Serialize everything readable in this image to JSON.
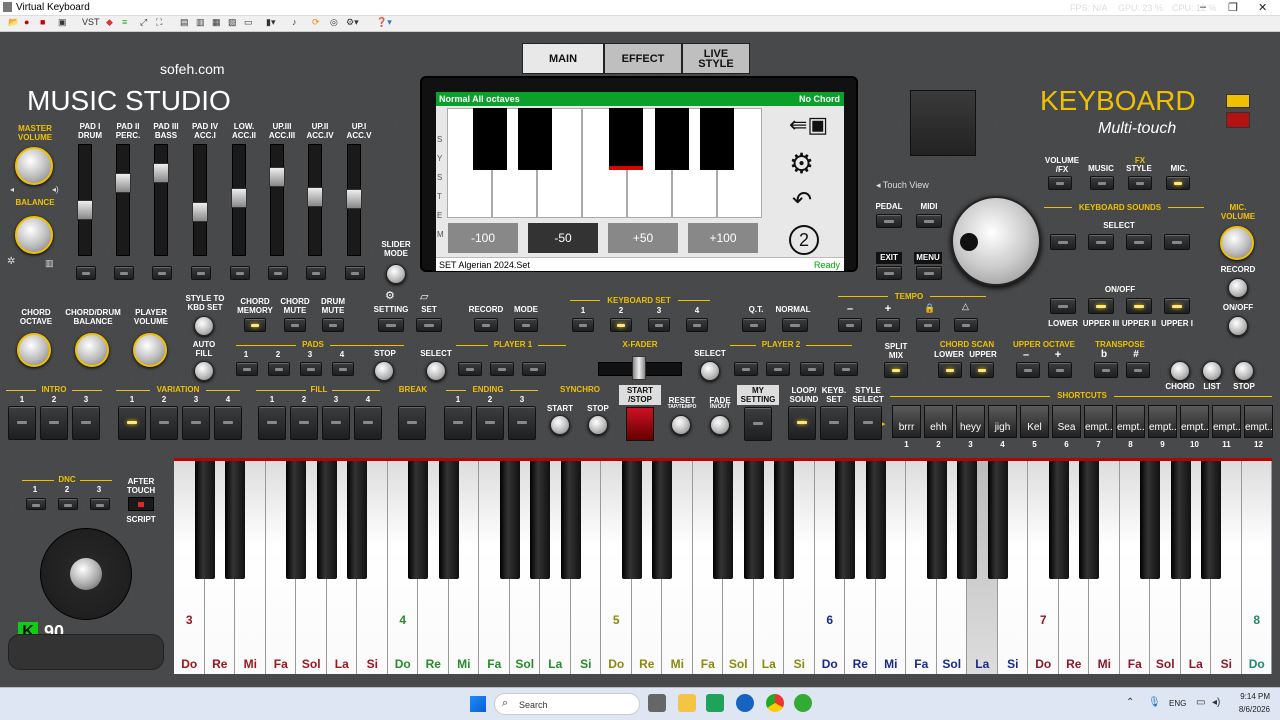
{
  "window": {
    "title": "Virtual Keyboard",
    "controls": [
      "–",
      "❐",
      "✕"
    ]
  },
  "toolbar": {
    "vst": "VST"
  },
  "overlay": {
    "fps": "FPS: N/A",
    "gpu": "GPU: 23 %",
    "cpu": "CPU: 12 %"
  },
  "brand": {
    "site": "sofeh.com",
    "app": "MUSIC STUDIO",
    "kb": "KEYBOARD",
    "kb_sub": "Multi-touch"
  },
  "tabs": [
    {
      "label": "MAIN"
    },
    {
      "label": "EFFECT"
    },
    {
      "label": "LIVE\nSTYLE"
    }
  ],
  "screen": {
    "header": "Normal All octaves",
    "chord": "No Chord",
    "side": "S\nY\nS\nT\nE\nM",
    "values": [
      "-100",
      "-50",
      "+50",
      "+100"
    ],
    "footer_set": "SET Algerian 2024.Set",
    "status": "Ready",
    "page": "2"
  },
  "left": {
    "master_volume": "MASTER\nVOLUME",
    "balance": "BALANCE",
    "pads": [
      "PAD I\nDRUM",
      "PAD II\nPERC.",
      "PAD III\nBASS",
      "PAD IV\nACC.I",
      "LOW.\nACC.II",
      "UP.III\nACC.III",
      "UP.II\nACC.IV",
      "UP.I\nACC.V"
    ],
    "slider_mode": "SLIDER\nMODE"
  },
  "row2": {
    "chord_octave": "CHORD\nOCTAVE",
    "chord_drum_balance": "CHORD/DRUM\nBALANCE",
    "player_volume": "PLAYER\nVOLUME",
    "style_to_kbd": "STYLE TO\nKBD SET",
    "auto_fill": "AUTO\nFILL",
    "chord_memory": "CHORD\nMEMORY",
    "chord_mute": "CHORD\nMUTE",
    "drum_mute": "DRUM\nMUTE",
    "setting": "SETTING",
    "set": "SET",
    "record": "RECORD",
    "mode": "MODE",
    "keyboard_set": "KEYBOARD SET",
    "kbset_nums": [
      "1",
      "2",
      "3",
      "4"
    ],
    "qt": "Q.T.",
    "normal": "NORMAL",
    "tempo": "TEMPO",
    "tempo_btns": [
      "–",
      "+"
    ],
    "pads_lbl": "PADS",
    "pads_nums": [
      "1",
      "2",
      "3",
      "4"
    ],
    "stop": "STOP",
    "select": "SELECT",
    "player1": "PLAYER 1",
    "xfader": "X-FADER",
    "player2": "PLAYER 2",
    "select2": "SELECT",
    "split_mix": "SPLIT\nMIX",
    "chord_scan": "CHORD SCAN",
    "lower": "LOWER",
    "upper": "UPPER",
    "upper_octave": "UPPER OCTAVE",
    "uo_btns": [
      "–",
      "+"
    ],
    "transpose": "TRANSPOSE",
    "tr_btns": [
      "b",
      "#"
    ]
  },
  "right": {
    "volume_fx": "VOLUME\n/FX",
    "fx": "FX",
    "music": "MUSIC",
    "style": "STYLE",
    "mic": "MIC.",
    "touch_view": "Touch View",
    "pedal": "PEDAL",
    "midi": "MIDI",
    "exit": "EXIT",
    "menu": "MENU",
    "keyboard_sounds": "KEYBOARD SOUNDS",
    "select": "SELECT",
    "on_off": "ON/OFF",
    "sound_labels": [
      "LOWER",
      "UPPER III",
      "UPPER II",
      "UPPER I"
    ],
    "mic_volume": "MIC.\nVOLUME",
    "record": "RECORD",
    "on_off2": "ON/OFF",
    "chord": "CHORD",
    "list": "LIST",
    "stop": "STOP"
  },
  "row3": {
    "intro": "INTRO",
    "intro_n": [
      "1",
      "2",
      "3"
    ],
    "variation": "VARIATION",
    "var_n": [
      "1",
      "2",
      "3",
      "4"
    ],
    "fill": "FILL",
    "fill_n": [
      "1",
      "2",
      "3",
      "4"
    ],
    "break": "BREAK",
    "ending": "ENDING",
    "end_n": [
      "1",
      "2",
      "3"
    ],
    "synchro": "SYNCHRO",
    "start": "START",
    "stop": "STOP",
    "start_stop": "START\n/STOP",
    "reset": "RESET",
    "tap_tempo": "TAP/TEMPO",
    "fade": "FADE",
    "in_out": "IN/OUT",
    "my_setting": "MY\nSETTING",
    "loop_sound": "LOOP/\nSOUND",
    "keyb_set": "KEYB.\nSET",
    "style_select": "STYLE\nSELECT",
    "shortcuts_lbl": "SHORTCUTS"
  },
  "shortcuts": [
    {
      "label": "brrr",
      "n": "1"
    },
    {
      "label": "ehh",
      "n": "2"
    },
    {
      "label": "heyy",
      "n": "3"
    },
    {
      "label": "jigh",
      "n": "4"
    },
    {
      "label": "Kel",
      "n": "5"
    },
    {
      "label": "Sea",
      "n": "6"
    },
    {
      "label": "empt..",
      "n": "7"
    },
    {
      "label": "empt..",
      "n": "8"
    },
    {
      "label": "empt..",
      "n": "9"
    },
    {
      "label": "empt..",
      "n": "10"
    },
    {
      "label": "empt..",
      "n": "11"
    },
    {
      "label": "empt..",
      "n": "12"
    }
  ],
  "dnc": {
    "label": "DNC",
    "nums": [
      "1",
      "2",
      "3"
    ],
    "after_touch": "AFTER\nTOUCH",
    "script": "SCRIPT"
  },
  "velocity": {
    "value": "90"
  },
  "piano": {
    "notes": [
      "Do",
      "Re",
      "Mi",
      "Fa",
      "Sol",
      "La",
      "Si",
      "Do",
      "Re",
      "Mi",
      "Fa",
      "Sol",
      "La",
      "Si",
      "Do",
      "Re",
      "Mi",
      "Fa",
      "Sol",
      "La",
      "Si",
      "Do",
      "Re",
      "Mi",
      "Fa",
      "Sol",
      "La",
      "Si",
      "Do",
      "Re",
      "Mi",
      "Fa",
      "Sol",
      "La",
      "Si",
      "Do"
    ],
    "octaves": [
      "3",
      "4",
      "5",
      "6",
      "7",
      "8"
    ],
    "pressed_index": 26,
    "colors": {
      "Do": "#a0141e",
      "Re": "#a0141e",
      "Mi": "#a0141e",
      "Fa": "#a0141e",
      "Sol": "#a0141e",
      "La": "#a0141e",
      "Si": "#a0141e"
    }
  },
  "taskbar": {
    "search": "Search",
    "lang": "ENG",
    "time": "9:14 PM",
    "date": "8/6/2026"
  }
}
